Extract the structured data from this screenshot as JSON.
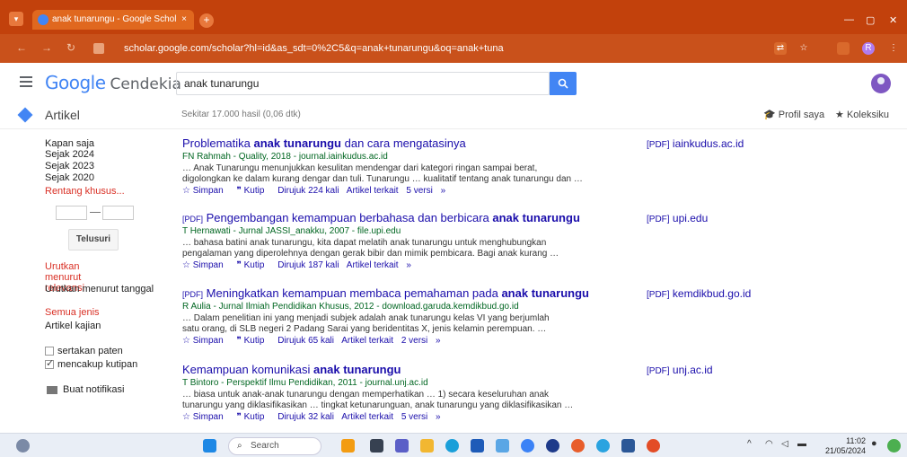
{
  "browser": {
    "tab_title": "anak tunarungu - Google Schol",
    "tab_close": "×",
    "new_tab": "+",
    "url": "scholar.google.com/scholar?hl=id&as_sdt=0%2C5&q=anak+tunarungu&oq=anak+tuna",
    "profile_letter": "R",
    "win_min": "—",
    "win_max": "▢",
    "win_close": "✕"
  },
  "header": {
    "logo_google": "Google",
    "logo_cendekia": "Cendekia",
    "search_value": "anak tunarungu"
  },
  "subbar": {
    "title": "Artikel",
    "result_count": "Sekitar 17.000 hasil (0,06 dtk)",
    "profile": "Profil saya",
    "library": "Koleksiku"
  },
  "sidebar": {
    "time_filters": [
      "Kapan saja",
      "Sejak 2024",
      "Sejak 2023",
      "Sejak 2020"
    ],
    "custom_range": "Rentang khusus...",
    "search_button": "Telusuri",
    "sort_relevance": "Urutkan menurut relevansi",
    "sort_date": "Urutkan menurut tanggal",
    "type_all": "Semua jenis",
    "type_review": "Artikel kajian",
    "include_patents": "sertakan paten",
    "include_citations": "mencakup kutipan",
    "create_alert": "Buat notifikasi"
  },
  "results": [
    {
      "pdf_tag": "",
      "title_pre": "Problematika ",
      "title_bold": "anak tunarungu",
      "title_post": " dan cara mengatasinya",
      "authors": "FN Rahmah - Quality, 2018 - journal.iainkudus.ac.id",
      "snippet_1": "… Anak Tunarungu menunjukkan kesulitan mendengar dari kategori ringan sampai berat,",
      "snippet_2": "digolongkan ke dalam kurang dengar dan tuli. Tunarungu … kualitatif tentang anak tunarungu dan …",
      "save": "Simpan",
      "cite": "Kutip",
      "cited_by": "Dirujuk 224 kali",
      "related": "Artikel terkait",
      "versions": "5 versi",
      "side_tag": "[PDF]",
      "side_domain": "iainkudus.ac.id"
    },
    {
      "pdf_tag": "[PDF]",
      "title_pre": "Pengembangan kemampuan berbahasa dan berbicara ",
      "title_bold": "anak tunarungu",
      "title_post": "",
      "authors": "T Hernawati - Jurnal JASSI_anakku, 2007 - file.upi.edu",
      "snippet_1": "… bahasa batini anak tunarungu, kita dapat melatih anak tunarungu untuk menghubungkan",
      "snippet_2": "pengalaman yang diperolehnya dengan gerak bibir dan mimik pembicara. Bagi anak kurang …",
      "save": "Simpan",
      "cite": "Kutip",
      "cited_by": "Dirujuk 187 kali",
      "related": "Artikel terkait",
      "versions": "",
      "side_tag": "[PDF]",
      "side_domain": "upi.edu"
    },
    {
      "pdf_tag": "[PDF]",
      "title_pre": "Meningkatkan kemampuan membaca pemahaman pada ",
      "title_bold": "anak tunarungu",
      "title_post": "",
      "authors": "R Aulia - Jurnal Ilmiah Pendidikan Khusus, 2012 - download.garuda.kemdikbud.go.id",
      "snippet_1": "… Dalam penelitian ini yang menjadi subjek adalah anak tunarungu kelas VI yang berjumlah",
      "snippet_2": "satu orang, di SLB negeri 2 Padang Sarai yang beridentitas X, jenis kelamin perempuan. …",
      "save": "Simpan",
      "cite": "Kutip",
      "cited_by": "Dirujuk 65 kali",
      "related": "Artikel terkait",
      "versions": "2 versi",
      "side_tag": "[PDF]",
      "side_domain": "kemdikbud.go.id"
    },
    {
      "pdf_tag": "",
      "title_pre": "Kemampuan komunikasi ",
      "title_bold": "anak tunarungu",
      "title_post": "",
      "authors": "T Bintoro - Perspektif Ilmu Pendidikan, 2011 - journal.unj.ac.id",
      "snippet_1": "… biasa untuk anak-anak tunarungu dengan memperhatikan … 1) secara keseluruhan anak",
      "snippet_2": "tunarungu yang diklasifikasikan … tingkat ketunarunguan, anak tunarungu yang diklasifikasikan …",
      "save": "Simpan",
      "cite": "Kutip",
      "cited_by": "Dirujuk 32 kali",
      "related": "Artikel terkait",
      "versions": "5 versi",
      "side_tag": "[PDF]",
      "side_domain": "unj.ac.id"
    }
  ],
  "taskbar": {
    "search_placeholder": "Search",
    "time": "11:02",
    "date": "21/05/2024"
  },
  "colors": {
    "browser": "#c2410c",
    "link": "#1a0dab",
    "author": "#006621",
    "accent": "#4285f4"
  }
}
